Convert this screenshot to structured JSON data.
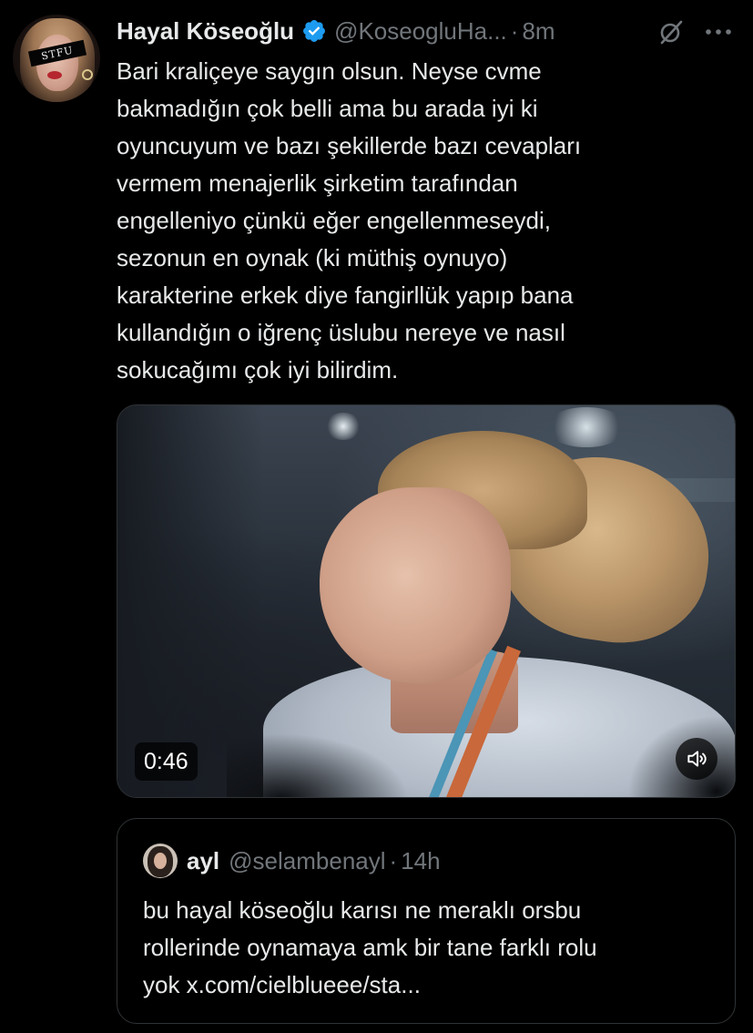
{
  "tweet": {
    "author_name": "Hayal Köseoğlu",
    "handle": "@KoseogluHa...",
    "separator": "·",
    "time": "8m",
    "avatar_text": "STFU",
    "icons": {
      "verified": "verified-badge-icon",
      "grok": "grok-icon",
      "more": "more-options-icon"
    },
    "text": "Bari kraliçeye saygın olsun. Neyse cvme\nbakmadığın çok belli ama bu arada iyi ki\noyuncuyum ve bazı şekillerde bazı cevapları\nvermem menajerlik şirketim tarafından\nengelleniyo çünkü eğer engellenmeseydi,\nsezonun en oynak (ki müthiş oynuyo)\nkarakterine erkek diye fangirllük yapıp bana\nkullandığın o iğrenç üslubu nereye ve nasıl\nsokucağımı çok iyi bilirdim."
  },
  "media": {
    "type": "video",
    "duration": "0:46",
    "icons": {
      "volume": "volume-icon"
    }
  },
  "quoted_tweet": {
    "author_name": "ayl",
    "handle": "@selambenayl",
    "separator": "·",
    "time": "14h",
    "text": "bu hayal köseoğlu karısı ne meraklı orsbu\nrollerinde oynamaya amk bir tane farklı rolu\nyok x.com/cielblueee/sta..."
  },
  "colors": {
    "background": "#000000",
    "text_primary": "#e7e9ea",
    "text_secondary": "#71767b",
    "border": "#2f3336",
    "verified_blue": "#1d9bf0"
  }
}
